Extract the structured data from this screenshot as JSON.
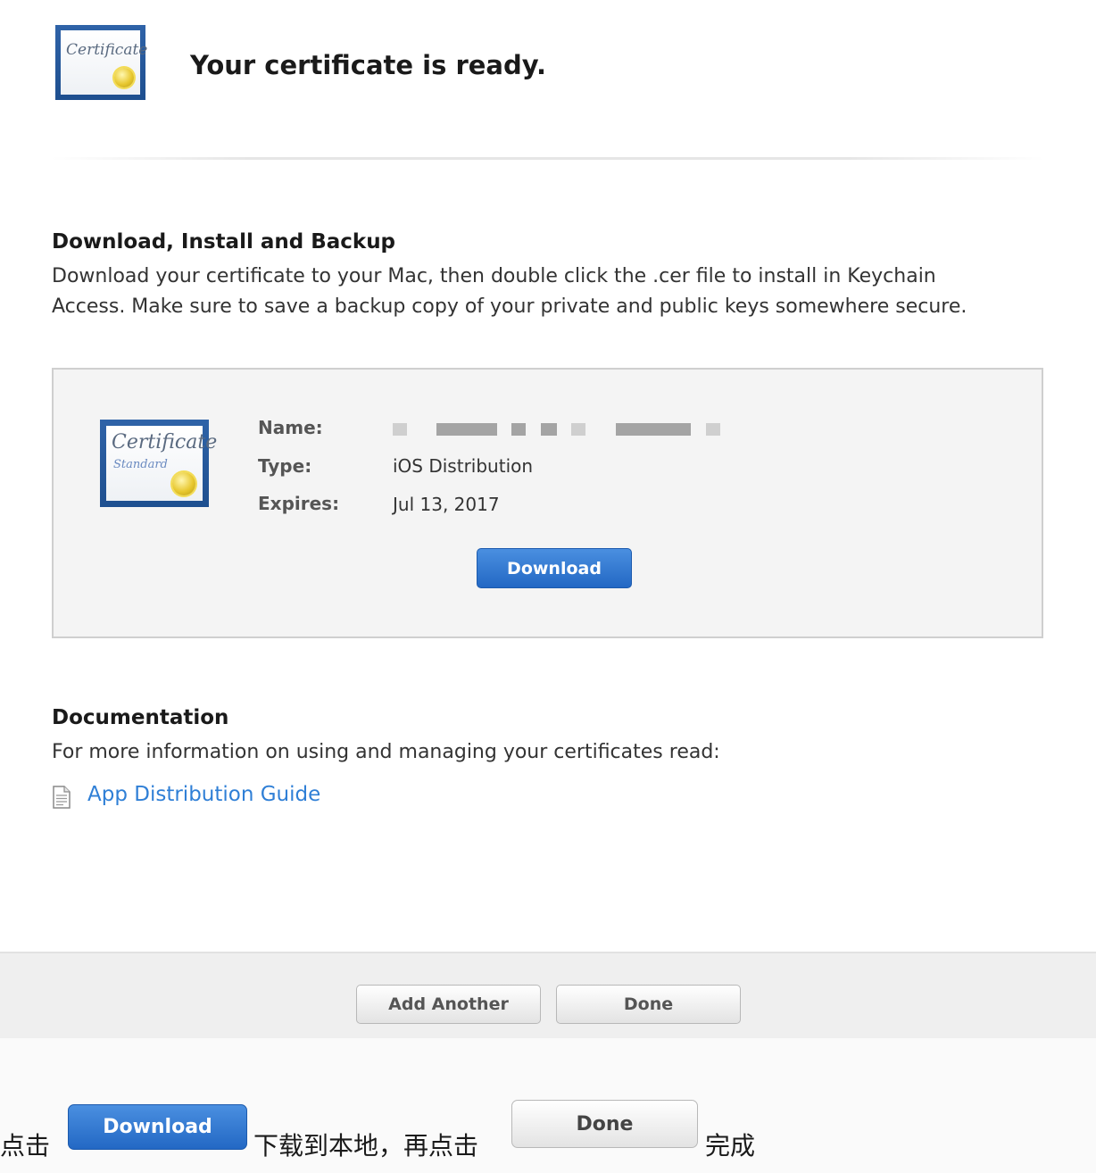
{
  "header": {
    "title": "Your certificate is ready.",
    "icon_script": "Certificate"
  },
  "install_section": {
    "heading": "Download, Install and Backup",
    "description_line1": "Download your certificate to your Mac, then double click the .cer file to install in Keychain",
    "description_line2": "Access. Make sure to save a backup copy of your private and public keys somewhere secure."
  },
  "certificate": {
    "icon_script": "Certificate",
    "icon_subscript": "Standard",
    "name_label": "Name:",
    "type_label": "Type:",
    "type_value": "iOS Distribution",
    "expires_label": "Expires:",
    "expires_value": "Jul 13, 2017",
    "download_label": "Download"
  },
  "documentation": {
    "heading": "Documentation",
    "description": "For more information on using and managing your certificates read:",
    "link_label": "App Distribution Guide"
  },
  "footer": {
    "add_another_label": "Add Another",
    "done_label": "Done"
  },
  "caption": {
    "part1": "点击",
    "download_label": "Download",
    "part2": "下载到本地，再点击",
    "done_label": "Done",
    "part3": "完成"
  },
  "colors": {
    "accent_blue": "#2368c4",
    "link_blue": "#2f7fd6",
    "panel_bg": "#f4f4f4"
  }
}
